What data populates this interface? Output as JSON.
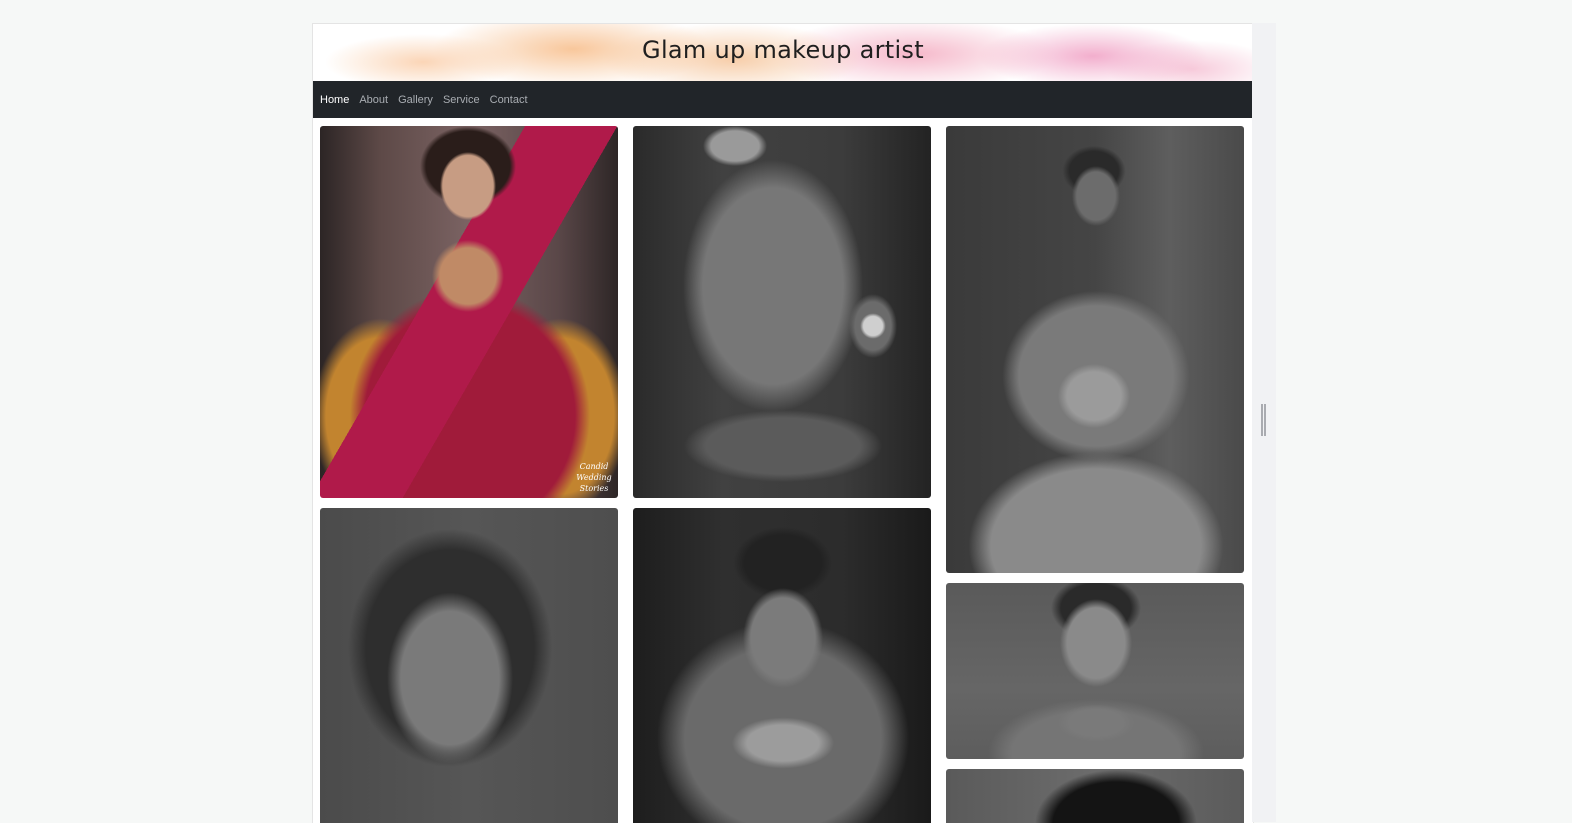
{
  "site": {
    "title": "Glam up makeup artist"
  },
  "nav": {
    "items": [
      {
        "label": "Home",
        "active": true
      },
      {
        "label": "About",
        "active": false
      },
      {
        "label": "Gallery",
        "active": false
      },
      {
        "label": "Service",
        "active": false
      },
      {
        "label": "Contact",
        "active": false
      }
    ]
  },
  "gallery": {
    "photos": [
      {
        "subject": "bride in red and gold saree",
        "style": "color",
        "watermark": "Candid Wedding Stories"
      },
      {
        "subject": "bride close-up with maang tikka and jhumka",
        "style": "grayscale"
      },
      {
        "subject": "bride in white lace gown with bouquet",
        "style": "grayscale"
      },
      {
        "subject": "model with glam eye makeup",
        "style": "grayscale"
      },
      {
        "subject": "bride with veil and choker necklace",
        "style": "grayscale"
      },
      {
        "subject": "smiling bride with necklace and earrings",
        "style": "grayscale"
      },
      {
        "subject": "bride portrait (partially visible)",
        "style": "grayscale"
      }
    ]
  },
  "colors": {
    "navbar_bg": "#212529",
    "nav_active": "#ffffff",
    "nav_inactive": "#a9adb2",
    "page_bg": "#f6f8f7"
  }
}
